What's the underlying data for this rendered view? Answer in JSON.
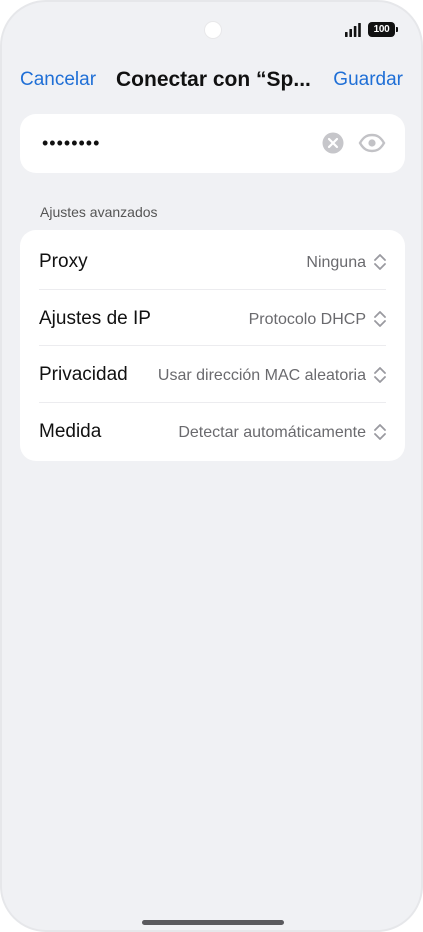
{
  "status_bar": {
    "battery_level": "100"
  },
  "nav": {
    "cancel_label": "Cancelar",
    "title": "Conectar con “Sp...",
    "save_label": "Guardar"
  },
  "password": {
    "value": "••••••••"
  },
  "advanced": {
    "section_title": "Ajustes avanzados",
    "rows": [
      {
        "label": "Proxy",
        "value": "Ninguna"
      },
      {
        "label": "Ajustes de IP",
        "value": "Protocolo DHCP"
      },
      {
        "label": "Privacidad",
        "value": "Usar dirección MAC aleatoria"
      },
      {
        "label": "Medida",
        "value": "Detectar automáticamente"
      }
    ]
  },
  "colors": {
    "accent": "#1f6fd6",
    "background": "#f0f1f4",
    "card": "#ffffff"
  },
  "icons": {
    "clear": "clear-icon",
    "eye": "eye-icon",
    "chevron": "chevron-up-down-icon",
    "signal": "signal-icon",
    "battery": "battery-icon"
  }
}
